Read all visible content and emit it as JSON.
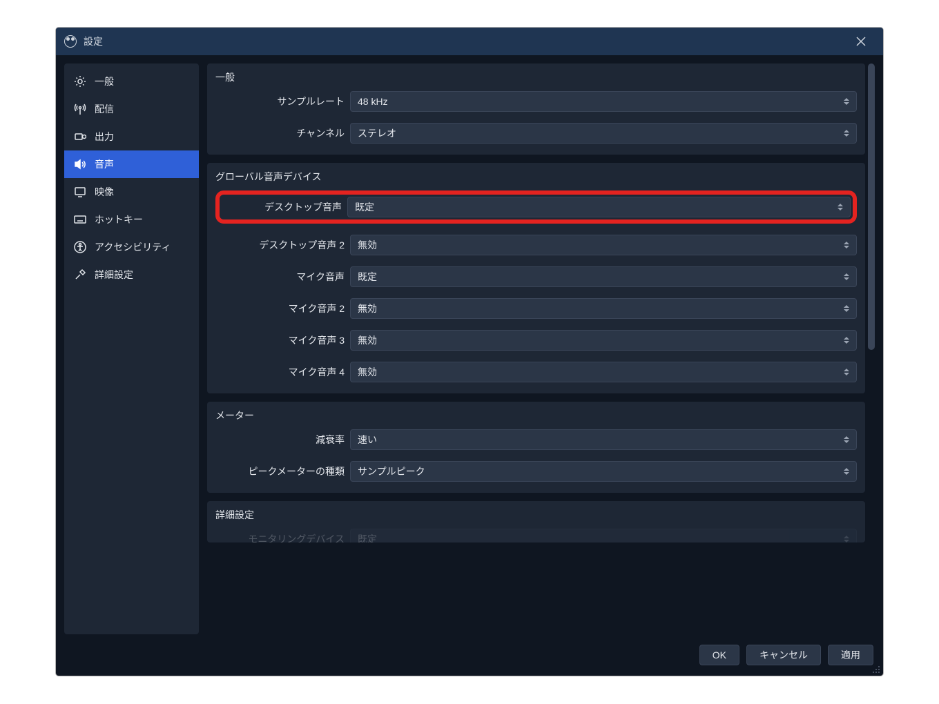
{
  "window": {
    "title": "設定"
  },
  "sidebar": {
    "items": [
      {
        "label": "一般"
      },
      {
        "label": "配信"
      },
      {
        "label": "出力"
      },
      {
        "label": "音声"
      },
      {
        "label": "映像"
      },
      {
        "label": "ホットキー"
      },
      {
        "label": "アクセシビリティ"
      },
      {
        "label": "詳細設定"
      }
    ]
  },
  "sections": {
    "general": {
      "title": "一般",
      "sample_rate_label": "サンプルレート",
      "sample_rate_value": "48 kHz",
      "channels_label": "チャンネル",
      "channels_value": "ステレオ"
    },
    "global_audio": {
      "title": "グローバル音声デバイス",
      "desktop1_label": "デスクトップ音声",
      "desktop1_value": "既定",
      "desktop2_label": "デスクトップ音声 2",
      "desktop2_value": "無効",
      "mic1_label": "マイク音声",
      "mic1_value": "既定",
      "mic2_label": "マイク音声 2",
      "mic2_value": "無効",
      "mic3_label": "マイク音声 3",
      "mic3_value": "無効",
      "mic4_label": "マイク音声 4",
      "mic4_value": "無効"
    },
    "meter": {
      "title": "メーター",
      "decay_label": "減衰率",
      "decay_value": "速い",
      "peak_type_label": "ピークメーターの種類",
      "peak_type_value": "サンプルピーク"
    },
    "advanced": {
      "title": "詳細設定",
      "monitoring_label": "モニタリングデバイス",
      "monitoring_value": "既定"
    }
  },
  "footer": {
    "ok": "OK",
    "cancel": "キャンセル",
    "apply": "適用"
  }
}
